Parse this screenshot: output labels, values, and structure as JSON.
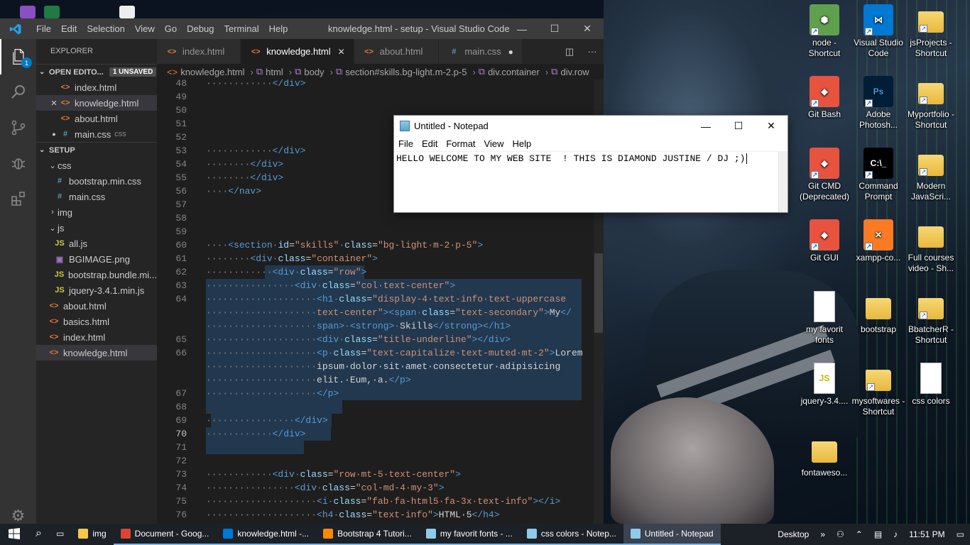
{
  "vscode": {
    "menu": [
      "File",
      "Edit",
      "Selection",
      "View",
      "Go",
      "Debug",
      "Terminal",
      "Help"
    ],
    "window_title": "knowledge.html - setup - Visual Studio Code",
    "explorer_title": "EXPLORER",
    "open_editors": {
      "label": "OPEN EDITO...",
      "badge": "1 UNSAVED",
      "items": [
        {
          "icon": "<>",
          "name": "index.html",
          "type": "h",
          "state": ""
        },
        {
          "icon": "<>",
          "name": "knowledge.html",
          "type": "h",
          "state": "close"
        },
        {
          "icon": "<>",
          "name": "about.html",
          "type": "h",
          "state": ""
        },
        {
          "icon": "#",
          "name": "main.css",
          "type": "c",
          "state": "dirty",
          "sub": "css"
        }
      ]
    },
    "setup": {
      "label": "SETUP",
      "tree": [
        {
          "indent": 1,
          "chev": "v",
          "icon": "",
          "name": "css",
          "type": ""
        },
        {
          "indent": 2,
          "chev": "",
          "icon": "#",
          "name": "bootstrap.min.css",
          "type": "c"
        },
        {
          "indent": 2,
          "chev": "",
          "icon": "#",
          "name": "main.css",
          "type": "c"
        },
        {
          "indent": 1,
          "chev": ">",
          "icon": "",
          "name": "img",
          "type": ""
        },
        {
          "indent": 1,
          "chev": "v",
          "icon": "",
          "name": "js",
          "type": ""
        },
        {
          "indent": 2,
          "chev": "",
          "icon": "JS",
          "name": "all.js",
          "type": "j"
        },
        {
          "indent": 2,
          "chev": "",
          "icon": "▣",
          "name": "BGIMAGE.png",
          "type": "p"
        },
        {
          "indent": 2,
          "chev": "",
          "icon": "JS",
          "name": "bootstrap.bundle.mi...",
          "type": "j"
        },
        {
          "indent": 2,
          "chev": "",
          "icon": "JS",
          "name": "jquery-3.4.1.min.js",
          "type": "j"
        },
        {
          "indent": 1,
          "chev": "",
          "icon": "<>",
          "name": "about.html",
          "type": "h"
        },
        {
          "indent": 1,
          "chev": "",
          "icon": "<>",
          "name": "basics.html",
          "type": "h"
        },
        {
          "indent": 1,
          "chev": "",
          "icon": "<>",
          "name": "index.html",
          "type": "h"
        },
        {
          "indent": 1,
          "chev": "",
          "icon": "<>",
          "name": "knowledge.html",
          "type": "h",
          "selected": true
        }
      ]
    },
    "tabs": [
      {
        "icon": "<>",
        "label": "index.html",
        "type": "h",
        "active": false,
        "tail": ""
      },
      {
        "icon": "<>",
        "label": "knowledge.html",
        "type": "h",
        "active": true,
        "tail": "×"
      },
      {
        "icon": "<>",
        "label": "about.html",
        "type": "h",
        "active": false,
        "tail": ""
      },
      {
        "icon": "#",
        "label": "main.css",
        "type": "c",
        "active": false,
        "tail": "●"
      }
    ],
    "breadcrumb": [
      "knowledge.html",
      "html",
      "body",
      "section#skills.bg-light.m-2.p-5",
      "div.container",
      "div.row"
    ],
    "badge_count": "1",
    "code_lines": [
      {
        "n": "48",
        "html": "<span class='pu'>············</span><span class='tg'>&lt;/div&gt;</span>"
      },
      {
        "n": "49",
        "html": ""
      },
      {
        "n": "50",
        "html": ""
      },
      {
        "n": "51",
        "html": ""
      },
      {
        "n": "52",
        "html": ""
      },
      {
        "n": "53",
        "html": "<span class='pu'>············</span><span class='tg'>&lt;/div&gt;</span>"
      },
      {
        "n": "54",
        "html": "<span class='pu'>········</span><span class='tg'>&lt;/div&gt;</span>"
      },
      {
        "n": "55",
        "html": "<span class='pu'>········</span><span class='tg'>&lt;/div&gt;</span>"
      },
      {
        "n": "56",
        "html": "<span class='pu'>····</span><span class='tg'>&lt;/nav&gt;</span>"
      },
      {
        "n": "57",
        "html": ""
      },
      {
        "n": "58",
        "html": ""
      },
      {
        "n": "59",
        "html": ""
      },
      {
        "n": "60",
        "html": "<span class='pu'>····</span><span class='tg'>&lt;section</span><span class='pu'>·</span><span class='at'>id</span><span class='tx'>=</span><span class='st'>\"skills\"</span><span class='pu'>·</span><span class='at'>class</span><span class='tx'>=</span><span class='st'>\"bg-light·m-2·p-5\"</span><span class='tg'>&gt;</span>"
      },
      {
        "n": "61",
        "html": "<span class='pu'>········</span><span class='tg'>&lt;div</span><span class='pu'>·</span><span class='at'>class</span><span class='tx'>=</span><span class='st'>\"container\"</span><span class='tg'>&gt;</span>"
      },
      {
        "n": "62",
        "html": "<span class='pu'>············</span><span class='tg'>&lt;div</span><span class='pu'>·</span><span class='at'>class</span><span class='tx'>=</span><span class='st'>\"row\"</span><span class='tg'>&gt;</span>"
      },
      {
        "n": "63",
        "html": "<span class='pu'>················</span><span class='tg'>&lt;div</span><span class='pu'>·</span><span class='at'>class</span><span class='tx'>=</span><span class='st'>\"col·text-center\"</span><span class='tg'>&gt;</span>"
      },
      {
        "n": "64",
        "html": "<span class='pu'>····················</span><span class='tg'>&lt;h1</span><span class='pu'>·</span><span class='at'>class</span><span class='tx'>=</span><span class='st'>\"display-4·text-info·text-uppercase</span>"
      },
      {
        "n": "",
        "html": "<span class='pu'>····················</span><span class='st'>text-center\"</span><span class='tg'>&gt;&lt;span</span><span class='pu'>·</span><span class='at'>class</span><span class='tx'>=</span><span class='st'>\"text-secondary\"</span><span class='tg'>&gt;</span><span class='tx'>My</span><span class='tg'>&lt;/</span>"
      },
      {
        "n": "",
        "html": "<span class='pu'>····················</span><span class='tg'>span&gt;</span><span class='pu'>·</span><span class='tg'>&lt;strong&gt;</span><span class='pu'>·</span><span class='tx'>Skills</span><span class='tg'>&lt;/strong&gt;&lt;/h1&gt;</span>"
      },
      {
        "n": "65",
        "html": "<span class='pu'>····················</span><span class='tg'>&lt;div</span><span class='pu'>·</span><span class='at'>class</span><span class='tx'>=</span><span class='st'>\"title-underline\"</span><span class='tg'>&gt;&lt;/div&gt;</span>"
      },
      {
        "n": "66",
        "html": "<span class='pu'>····················</span><span class='tg'>&lt;p</span><span class='pu'>·</span><span class='at'>class</span><span class='tx'>=</span><span class='st'>\"text-capitalize·text-muted·mt-2\"</span><span class='tg'>&gt;</span><span class='tx'>Lorem</span>"
      },
      {
        "n": "",
        "html": "<span class='pu'>····················</span><span class='tx'>ipsum·dolor·sit·amet·consectetur·adipisicing</span>"
      },
      {
        "n": "",
        "html": "<span class='pu'>····················</span><span class='tx'>elit.·Eum,·a.</span><span class='tg'>&lt;/p&gt;</span>"
      },
      {
        "n": "67",
        "html": "<span class='pu'>····················</span><span class='tg'>&lt;/p&gt;</span>"
      },
      {
        "n": "68",
        "html": ""
      },
      {
        "n": "69",
        "html": "<span class='pu'>················</span><span class='tg'>&lt;/div&gt;</span>"
      },
      {
        "n": "70",
        "html": "<span class='pu'>············</span><span class='tg'>&lt;/div&gt;</span>"
      },
      {
        "n": "71",
        "html": ""
      },
      {
        "n": "72",
        "html": ""
      },
      {
        "n": "73",
        "html": "<span class='pu'>············</span><span class='tg'>&lt;div</span><span class='pu'>·</span><span class='at'>class</span><span class='tx'>=</span><span class='st'>\"row·mt-5·text-center\"</span><span class='tg'>&gt;</span>"
      },
      {
        "n": "74",
        "html": "<span class='pu'>················</span><span class='tg'>&lt;div</span><span class='pu'>·</span><span class='at'>class</span><span class='tx'>=</span><span class='st'>\"col-md-4·my-3\"</span><span class='tg'>&gt;</span>"
      },
      {
        "n": "75",
        "html": "<span class='pu'>····················</span><span class='tg'>&lt;i</span><span class='pu'>·</span><span class='at'>class</span><span class='tx'>=</span><span class='st'>\"fab·fa-html5·fa-3x·text-info\"</span><span class='tg'>&gt;&lt;/i&gt;</span>"
      },
      {
        "n": "76",
        "html": "<span class='pu'>····················</span><span class='tg'>&lt;h4</span><span class='pu'>·</span><span class='at'>class</span><span class='tx'>=</span><span class='st'>\"text-info\"</span><span class='tg'>&gt;</span><span class='tx'>HTML·5</span><span class='tg'>&lt;/h4&gt;</span>"
      }
    ]
  },
  "notepad": {
    "title": "Untitled - Notepad",
    "menu": [
      "File",
      "Edit",
      "Format",
      "View",
      "Help"
    ],
    "text": "HELLO WELCOME TO MY WEB SITE  ! THIS IS DIAMOND JUSTINE / DJ ;)"
  },
  "desktop_icons": [
    {
      "label": "node - Shortcut",
      "kind": "node",
      "color": "#5fa04e"
    },
    {
      "label": "Visual Studio Code",
      "kind": "vscode",
      "color": "#0078d4"
    },
    {
      "label": "jsProjects - Shortcut",
      "kind": "folder",
      "color": "#f2c94c"
    },
    {
      "label": "Git Bash",
      "kind": "git",
      "color": "#e8533f"
    },
    {
      "label": "Adobe Photosh...",
      "kind": "ps",
      "color": "#001e36"
    },
    {
      "label": "Myportfolio - Shortcut",
      "kind": "folder",
      "color": "#f2c94c"
    },
    {
      "label": "Git CMD (Deprecated)",
      "kind": "git",
      "color": "#e8533f"
    },
    {
      "label": "Command Prompt",
      "kind": "cmd",
      "color": "#000000"
    },
    {
      "label": "Modern JavaScri...",
      "kind": "folder",
      "color": "#f2c94c"
    },
    {
      "label": "Git GUI",
      "kind": "git",
      "color": "#e8533f"
    },
    {
      "label": "xampp-co...",
      "kind": "xampp",
      "color": "#fb7a24"
    },
    {
      "label": "Full courses video - Sh...",
      "kind": "folder",
      "color": "#f2c94c"
    },
    {
      "label": "my favorit fonts",
      "kind": "doc",
      "color": "#ffffff"
    },
    {
      "label": "bootstrap",
      "kind": "folder",
      "color": "#f2c94c"
    },
    {
      "label": "BbatcherR - Shortcut",
      "kind": "folder",
      "color": "#f2c94c"
    },
    {
      "label": "jquery-3.4....",
      "kind": "js",
      "color": "#ffffff"
    },
    {
      "label": "mysoftwares - Shortcut",
      "kind": "folder",
      "color": "#f2c94c"
    },
    {
      "label": "css colors",
      "kind": "doc",
      "color": "#ffffff"
    },
    {
      "label": "fontaweso...",
      "kind": "folder",
      "color": "#f2c94c"
    }
  ],
  "taskbar": {
    "items": [
      {
        "label": "img",
        "icon_color": "#f2c94c",
        "state": ""
      },
      {
        "label": "Document - Goog...",
        "icon_color": "#db4437",
        "state": "on"
      },
      {
        "label": "knowledge.html -...",
        "icon_color": "#0078d4",
        "state": "on"
      },
      {
        "label": "Bootstrap 4 Tutori...",
        "icon_color": "#ff8800",
        "state": "on"
      },
      {
        "label": "my favorit fonts - ...",
        "icon_color": "#8ecbe8",
        "state": "on"
      },
      {
        "label": "css colors - Notep...",
        "icon_color": "#8ecbe8",
        "state": "on"
      },
      {
        "label": "Untitled - Notepad",
        "icon_color": "#8ecbe8",
        "state": "act"
      }
    ],
    "desktop_label": "Desktop",
    "time": "11:51 PM"
  }
}
